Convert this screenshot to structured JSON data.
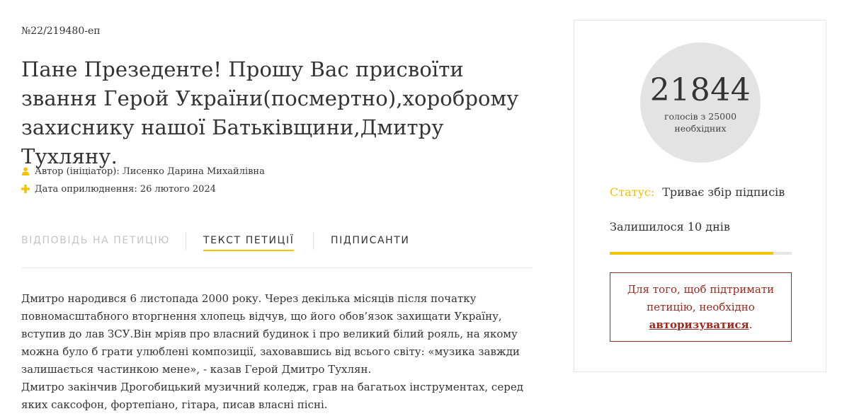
{
  "petition": {
    "number": "№22/219480-еп",
    "title": "Пане Презеденте! Прошу Вас присвоїти звання Герой України(посмертно),хороброму захиснику нашої Батьківщини,Дмитру Тухляну.",
    "author_label": "Автор (ініціатор):",
    "author": "Лисенко Дарина Михайлівна",
    "date_label": "Дата оприлюднення:",
    "date": "26 лютого 2024"
  },
  "tabs": [
    {
      "label": "Відповідь на петицію",
      "state": "disabled"
    },
    {
      "label": "Текст петиції",
      "state": "active"
    },
    {
      "label": "Підписанти",
      "state": "normal"
    }
  ],
  "text": {
    "paragraph1": "Дмитро народився 6 листопада 2000 року. Через декілька місяців після початку повномасштабного вторгнення хлопець відчув, що його обов’язок захищати Україну, вступив до лав ЗСУ.Він мріяв про власний будинок і про великий білий рояль, на якому можна було б грати улюблені композиції, заховавшись від всього світу: «музика завжди залишається частинкою мене», - казав Герой Дмитро Тухлян.",
    "paragraph2": "Дмитро закінчив Дрогобицький музичний коледж, грав на багатьох інструментах, серед яких саксофон, фортепіано, гітара, писав власні пісні."
  },
  "sidebar": {
    "votes": "21844",
    "votes_caption": "голосів з 25000 необхідних",
    "votes_needed": 25000,
    "status_label": "Статус:",
    "status_value": "Триває збір підписів",
    "remaining": "Залишилося 10 днів",
    "progress_fraction": 0.9,
    "auth_text_before": "Для того, щоб підтримати петицію, необхідно",
    "auth_link": "авторизуватися",
    "auth_text_after": "."
  },
  "colors": {
    "accent_yellow": "#f5c400",
    "auth_red": "#9a2a1e",
    "circle_gray": "#e3e3e3"
  },
  "icons": {
    "author": "user-icon",
    "date": "plus-icon"
  }
}
